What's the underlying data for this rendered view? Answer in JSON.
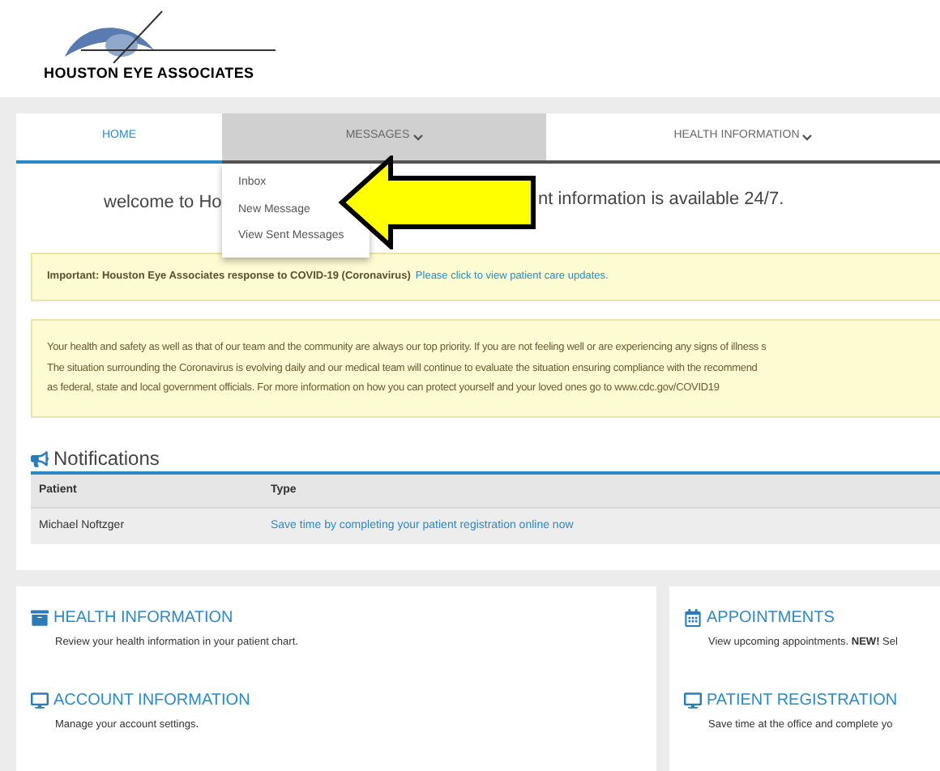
{
  "logo": {
    "text": "HOUSTON EYE ASSOCIATES"
  },
  "nav": {
    "tabs": [
      {
        "label": "HOME",
        "selected": true,
        "open": false,
        "dropdown": false
      },
      {
        "label": "MESSAGES",
        "selected": false,
        "open": true,
        "dropdown": true,
        "menu": [
          "Inbox",
          "New Message",
          "View Sent Messages"
        ]
      },
      {
        "label": "HEALTH INFORMATION",
        "selected": false,
        "open": false,
        "dropdown": true
      }
    ]
  },
  "welcome": {
    "left": "welcome to Ho",
    "right": "nt information is available 24/7."
  },
  "alert": {
    "text": "Important: Houston Eye Associates response to COVID-19 (Coronavirus)",
    "link": "Please click to view patient care updates."
  },
  "notice": {
    "lines": [
      "Your health and safety as well as that of our team and the community are always our top priority. If you are not feeling well or are experiencing any signs of illness s",
      "The situation surrounding the Coronavirus is evolving daily and our medical team will continue to evaluate the situation ensuring compliance with the recommend",
      "as federal, state and local government officials. For more information on how you can protect yourself and your loved ones go to www.cdc.gov/COVID19"
    ]
  },
  "notifications": {
    "title": "Notifications",
    "columns": [
      "Patient",
      "Type"
    ],
    "rows": [
      {
        "patient": "Michael Noftzger",
        "type": "Save time by completing your patient registration online now"
      }
    ]
  },
  "panels": [
    {
      "sections": [
        {
          "kind": "health",
          "title": "HEALTH INFORMATION",
          "text": "Review your health information in your patient chart."
        },
        {
          "kind": "account",
          "title": "ACCOUNT INFORMATION",
          "text": "Manage your account settings."
        }
      ]
    },
    {
      "sections": [
        {
          "kind": "appointments",
          "title": "APPOINTMENTS",
          "text": "View upcoming appointments. **NEW!** Sel"
        },
        {
          "kind": "registration",
          "title": "PATIENT REGISTRATION",
          "text": "Save time at the office and complete yo"
        }
      ]
    }
  ]
}
